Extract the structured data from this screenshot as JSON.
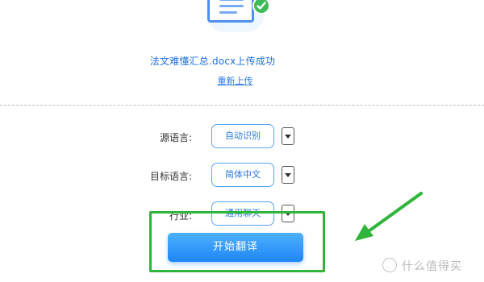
{
  "upload": {
    "status_text": "法文难懂汇总.docx上传成功",
    "reupload_label": "重新上传"
  },
  "form": {
    "source_language": {
      "label": "源语言:",
      "value": "自动识别"
    },
    "target_language": {
      "label": "目标语言:",
      "value": "简体中文"
    },
    "industry": {
      "label": "行业:",
      "value": "通用聊天"
    }
  },
  "start_button_label": "开始翻译",
  "watermark": {
    "text": "什么值得买"
  },
  "icons": {
    "document": "document-icon",
    "success": "checkmark-icon",
    "dropdown": "chevron-down-icon",
    "annotation_arrow": "arrow-icon",
    "watermark": "logo"
  },
  "colors": {
    "accent": "#1f86f5",
    "link": "#2e7be8",
    "success": "#3dbb58",
    "annotation": "#2fb53b"
  }
}
